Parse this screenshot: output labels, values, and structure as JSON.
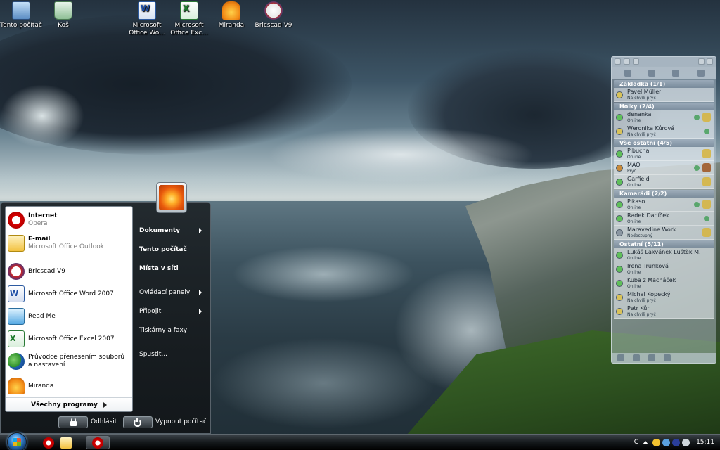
{
  "desktop": {
    "icons": [
      {
        "label": "Tento počítač",
        "icon": "computer-icon"
      },
      {
        "label": "Koš",
        "icon": "recycle-bin-icon"
      },
      {
        "label": "Microsoft Office Wo...",
        "icon": "word-icon"
      },
      {
        "label": "Microsoft Office Exc...",
        "icon": "excel-icon"
      },
      {
        "label": "Miranda",
        "icon": "miranda-icon"
      },
      {
        "label": "Bricscad V9",
        "icon": "bricscad-icon"
      }
    ]
  },
  "start_menu": {
    "programs": [
      {
        "title": "Internet",
        "sub": "Opera",
        "icon": "opera-icon"
      },
      {
        "title": "E-mail",
        "sub": "Microsoft Office Outlook",
        "icon": "outlook-icon"
      },
      {
        "title": "Bricscad V9",
        "sub": "",
        "icon": "bricscad-icon"
      },
      {
        "title": "Microsoft Office Word 2007",
        "sub": "",
        "icon": "word-icon"
      },
      {
        "title": "Read Me",
        "sub": "",
        "icon": "readme-icon"
      },
      {
        "title": "Microsoft Office Excel 2007",
        "sub": "",
        "icon": "excel-icon"
      },
      {
        "title": "Průvodce přenesením souborů a nastavení",
        "sub": "",
        "icon": "transfer-wizard-icon"
      },
      {
        "title": "Miranda",
        "sub": "",
        "icon": "miranda-icon"
      }
    ],
    "all_programs": "Všechny programy",
    "places": [
      {
        "label": "Dokumenty"
      },
      {
        "label": "Tento počítač"
      },
      {
        "label": "Místa v síti"
      },
      {
        "label": "Ovládací panely"
      },
      {
        "label": "Připojit"
      },
      {
        "label": "Tiskárny a faxy"
      },
      {
        "label": "Spustit..."
      }
    ],
    "logoff": "Odhlásit",
    "shutdown": "Vypnout počítač"
  },
  "taskbar": {
    "language": "C",
    "clock": "15:11"
  },
  "miranda": {
    "groups": [
      {
        "name": "Základka (1/1)",
        "contacts": [
          {
            "name": "Pavel Müller",
            "status": "Na chvíli pryč"
          }
        ]
      },
      {
        "name": "Holky (2/4)",
        "contacts": [
          {
            "name": "denanka",
            "status": "Online"
          },
          {
            "name": "Weronika Kůrová",
            "status": "Na chvíli pryč"
          }
        ]
      },
      {
        "name": "Vše ostatní (4/5)",
        "contacts": [
          {
            "name": "Pibucha",
            "status": "Online"
          },
          {
            "name": "MAO",
            "status": "Pryč"
          },
          {
            "name": "Garfield",
            "status": "Online"
          }
        ]
      },
      {
        "name": "Kamarádi (2/2)",
        "contacts": [
          {
            "name": "Pikaso",
            "status": "Online"
          },
          {
            "name": "Radek Daníček",
            "status": "Online"
          },
          {
            "name": "Maravedine Work",
            "status": "Nedostupný"
          }
        ]
      },
      {
        "name": "Ostatní (5/11)",
        "contacts": [
          {
            "name": "Lukáš Lakvánek Luštěk M...",
            "status": "Online"
          },
          {
            "name": "Irena Trunková",
            "status": "Online"
          },
          {
            "name": "Kuba z Macháček",
            "status": "Online"
          },
          {
            "name": "Michal Kopecký",
            "status": "Na chvíli pryč"
          },
          {
            "name": "Petr Kůr",
            "status": "Na chvíli pryč"
          }
        ]
      }
    ]
  },
  "colors": {
    "opera_red": "#d60000",
    "menu_bg": "#1c2226",
    "taskbar_bg": "#15191c"
  }
}
